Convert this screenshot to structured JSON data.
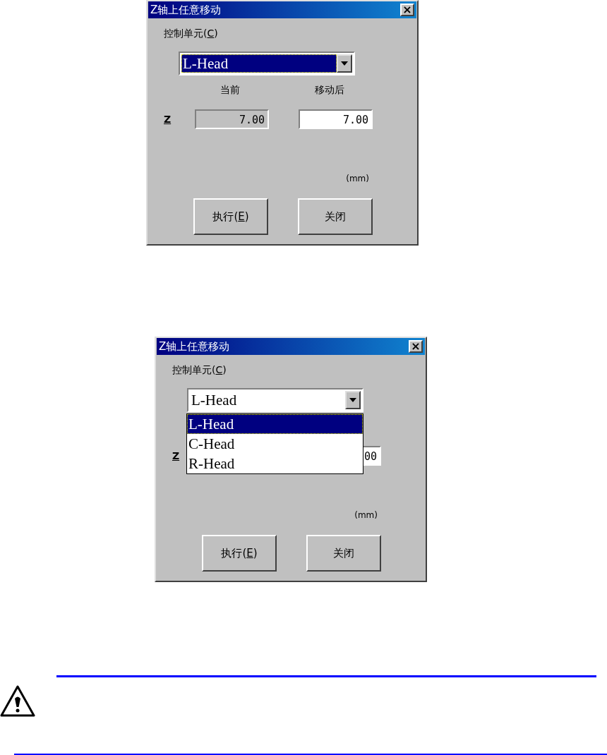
{
  "dialogs": [
    {
      "title": "Z轴上任意移动",
      "close": "×",
      "unit_label": {
        "prefix": "控制单元(",
        "key": "C",
        "suffix": ")"
      },
      "combo": {
        "value": "L-Head",
        "focused": true
      },
      "headers": [
        "当前",
        "移动后"
      ],
      "axis_label": "Z",
      "current": "7.00",
      "target": "7.00",
      "unit": "(mm)",
      "buttons": [
        {
          "prefix": "执行(",
          "key": "E",
          "suffix": ")"
        },
        {
          "prefix": "关闭"
        }
      ]
    },
    {
      "title": "Z轴上任意移动",
      "close": "×",
      "unit_label": {
        "prefix": "控制单元(",
        "key": "C",
        "suffix": ")"
      },
      "combo": {
        "value": "L-Head",
        "focused": false
      },
      "options": [
        {
          "label": "L-Head",
          "selected": true
        },
        {
          "label": "C-Head",
          "selected": false
        },
        {
          "label": "R-Head",
          "selected": false
        }
      ],
      "axis_label": "Z",
      "target": "00",
      "unit": "(mm)",
      "buttons": [
        {
          "prefix": "执行(",
          "key": "E",
          "suffix": ")"
        },
        {
          "prefix": "关闭"
        }
      ]
    }
  ]
}
